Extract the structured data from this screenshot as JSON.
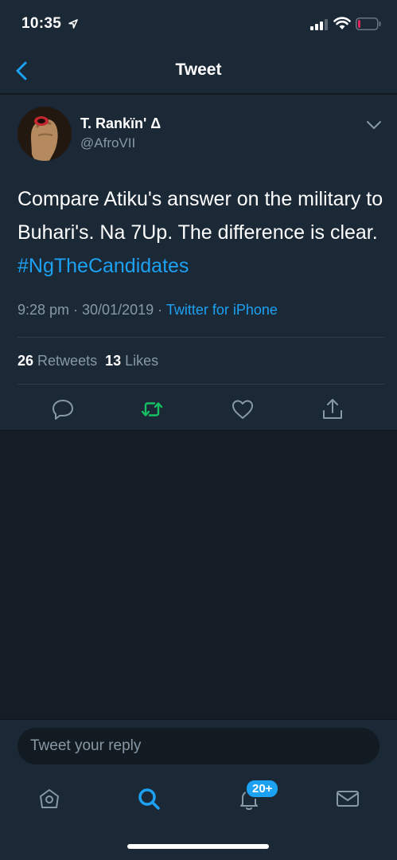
{
  "status_bar": {
    "time": "10:35"
  },
  "nav": {
    "title": "Tweet"
  },
  "tweet": {
    "display_name": "T. Rankïn' Δ",
    "handle": "@AfroVII",
    "text": "Compare Atiku's answer on the military to Buhari's. Na 7Up. The difference is clear.",
    "hashtag": "#NgTheCandidates",
    "timestamp": "9:28 pm · 30/01/2019 ·",
    "source": "Twitter for iPhone",
    "retweets_count": "26",
    "retweets_label": "Retweets",
    "likes_count": "13",
    "likes_label": "Likes"
  },
  "reply": {
    "placeholder": "Tweet your reply"
  },
  "tab_bar": {
    "notifications_badge": "20+"
  },
  "colors": {
    "accent": "#1da1f2",
    "retweet_active": "#17bf63",
    "background": "#141d26",
    "surface": "#1b2836",
    "secondary_text": "#8899a6"
  }
}
